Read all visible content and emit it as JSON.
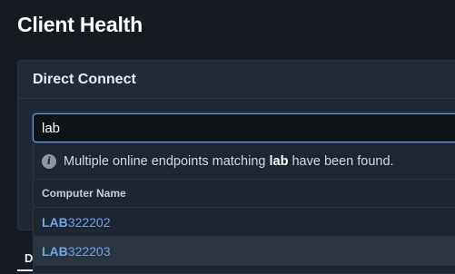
{
  "page": {
    "title": "Client Health"
  },
  "card": {
    "title": "Direct Connect"
  },
  "search": {
    "value": "lab",
    "placeholder": ""
  },
  "dropdown": {
    "info_prefix": "Multiple online endpoints matching ",
    "info_term": "lab",
    "info_suffix": " have been found.",
    "column_header": "Computer Name",
    "results": [
      {
        "match": "LAB",
        "rest": "322202"
      },
      {
        "match": "LAB",
        "rest": "322203"
      }
    ]
  },
  "behind": {
    "tab_partial": "D"
  },
  "colors": {
    "accent": "#6ea4ec",
    "focus_border": "#6b9fe6",
    "background": "#161b22"
  }
}
